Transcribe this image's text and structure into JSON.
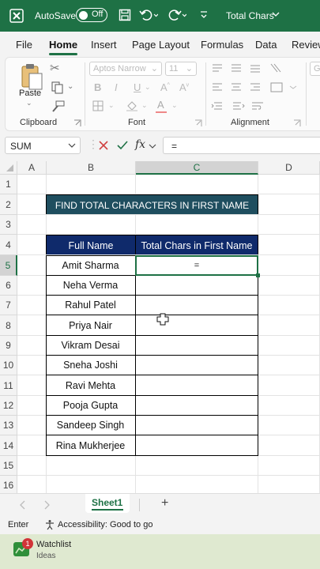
{
  "titlebar": {
    "autosave_label": "AutoSave",
    "autosave_state": "Off",
    "doc_title": "Total Chars",
    "icons": [
      "excel-icon",
      "save-icon",
      "undo-icon",
      "redo-icon",
      "customize-icon"
    ],
    "bg": "#1e7145"
  },
  "menu": {
    "tabs": [
      "File",
      "Home",
      "Insert",
      "Page Layout",
      "Formulas",
      "Data",
      "Review"
    ],
    "active": "Home"
  },
  "ribbon": {
    "clipboard_label": "Clipboard",
    "paste_label": "Paste",
    "font_label": "Font",
    "font_name": "Aptos Narrow",
    "font_size": "11",
    "alignment_label": "Alignment",
    "number_format": "Ge"
  },
  "formula_bar": {
    "name_box": "SUM",
    "fx_label": "fx",
    "formula": "="
  },
  "grid": {
    "columns": [
      "A",
      "B",
      "C",
      "D"
    ],
    "rows": [
      "1",
      "2",
      "3",
      "4",
      "5",
      "6",
      "7",
      "8",
      "9",
      "10",
      "11",
      "12",
      "13",
      "14",
      "15",
      "16"
    ],
    "title": "FIND TOTAL CHARACTERS IN FIRST NAME",
    "headers": [
      "Full Name",
      "Total Chars in First Name"
    ],
    "names": [
      "Amit Sharma",
      "Neha Verma",
      "Rahul Patel",
      "Priya Nair",
      "Vikram Desai",
      "Sneha Joshi",
      "Ravi Mehta",
      "Pooja Gupta",
      "Sandeep Singh",
      "Rina Mukherjee"
    ],
    "active_cell_value": "=",
    "title_bg": "#1f4e5f",
    "header_bg": "#0f2a6b"
  },
  "sheets": {
    "active": "Sheet1",
    "add_label": "+"
  },
  "status": {
    "mode": "Enter",
    "accessibility": "Accessibility: Good to go"
  },
  "taskbar": {
    "badge": "1",
    "app_title": "Watchlist",
    "app_subtitle": "Ideas"
  }
}
